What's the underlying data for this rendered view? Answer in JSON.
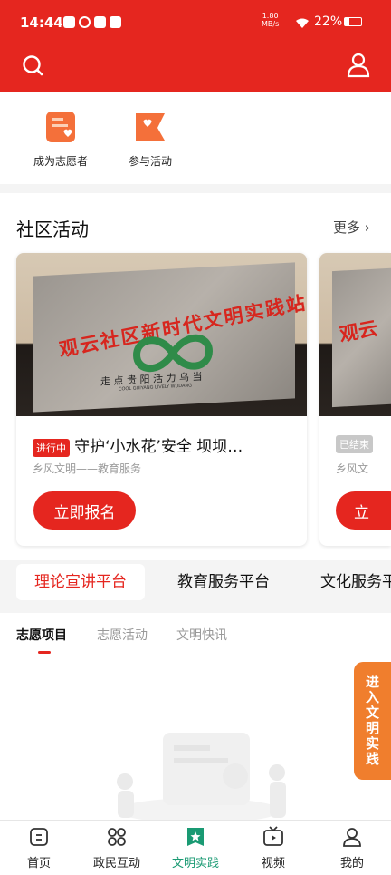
{
  "status_bar": {
    "time": "14:44",
    "net_speed_top": "1.80",
    "net_speed_bottom": "MB/s",
    "battery": "22%"
  },
  "header": {
    "search_icon": "search-icon",
    "user_icon": "user-icon"
  },
  "entries": [
    {
      "label": "成为志愿者",
      "icon": "volunteer-card-icon"
    },
    {
      "label": "参与活动",
      "icon": "flag-heart-icon"
    }
  ],
  "community": {
    "title": "社区活动",
    "more": "更多",
    "cards": [
      {
        "status": "进行中",
        "status_color": "#e5261f",
        "title": "守护‘小水花’安全 坝坝…",
        "subtitle": "乡风文明——教育服务",
        "button": "立即报名",
        "sign_text": "观云社区新时代文明实践站",
        "sign_slogan": "走 点 贵 阳  活 力 乌 当",
        "sign_slogan_en": "COOL GUIYANG   LIVELY WUDANG"
      },
      {
        "status": "已结束",
        "status_color": "#c8c8c8",
        "subtitle": "乡风文",
        "button": "立",
        "sign_text": "观云"
      }
    ]
  },
  "platform_tabs": [
    "理论宣讲平台",
    "教育服务平台",
    "文化服务平"
  ],
  "sub_tabs": [
    "志愿项目",
    "志愿活动",
    "文明快讯"
  ],
  "side_tab": "进入文明实践",
  "bottom_nav": [
    {
      "label": "首页",
      "icon": "home-icon"
    },
    {
      "label": "政民互动",
      "icon": "grid-icon"
    },
    {
      "label": "文明实践",
      "icon": "star-badge-icon",
      "active": true
    },
    {
      "label": "视频",
      "icon": "tv-icon"
    },
    {
      "label": "我的",
      "icon": "profile-icon"
    }
  ],
  "colors": {
    "brand_red": "#e5261f",
    "accent_orange": "#f07e2d",
    "active_green": "#1a9a73"
  }
}
